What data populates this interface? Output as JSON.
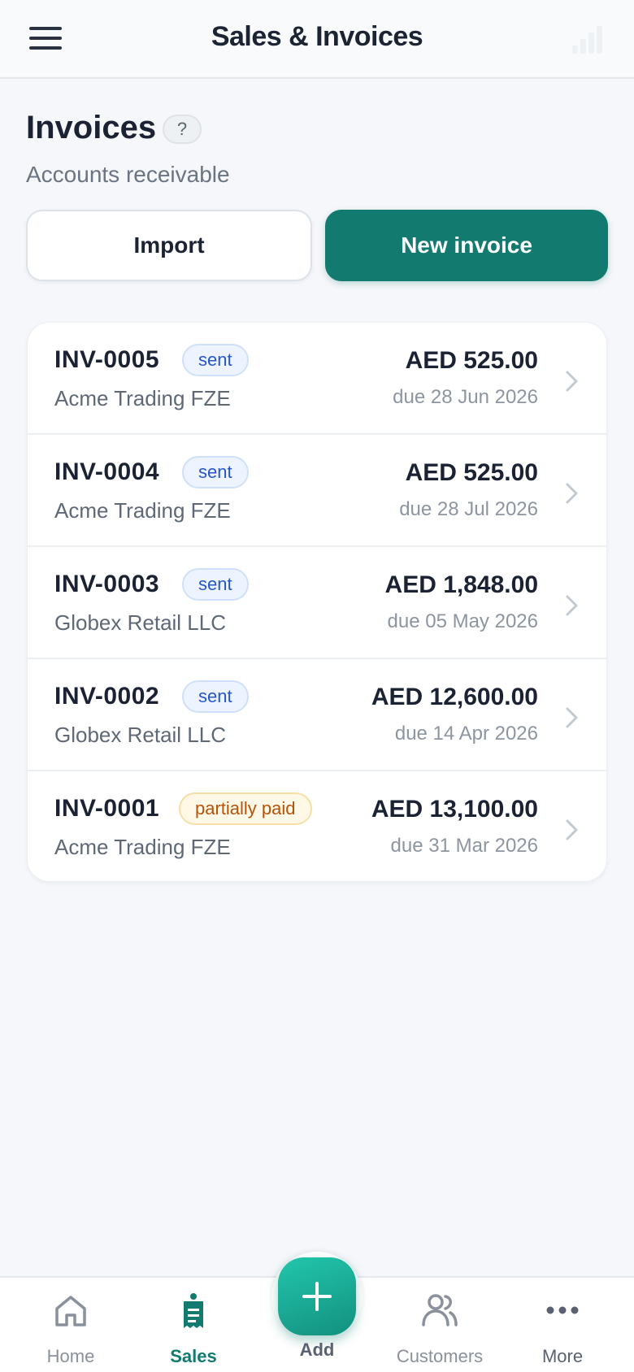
{
  "header": {
    "title": "Sales & Invoices",
    "menu_icon": "hamburger-menu-icon",
    "signal_icon": "signal-icon"
  },
  "page": {
    "title": "Invoices",
    "help": "?",
    "subtitle": "Accounts receivable"
  },
  "actions": {
    "import_label": "Import",
    "new_label": "New invoice"
  },
  "invoices": [
    {
      "number": "INV-0005",
      "status": "sent",
      "customer": "Acme Trading FZE",
      "amount": "AED 525.00",
      "due": "due 28 Jun 2026"
    },
    {
      "number": "INV-0004",
      "status": "sent",
      "customer": "Acme Trading FZE",
      "amount": "AED 525.00",
      "due": "due 28 Jul 2026"
    },
    {
      "number": "INV-0003",
      "status": "sent",
      "customer": "Globex Retail LLC",
      "amount": "AED 1,848.00",
      "due": "due 05 May 2026"
    },
    {
      "number": "INV-0002",
      "status": "sent",
      "customer": "Globex Retail LLC",
      "amount": "AED 12,600.00",
      "due": "due 14 Apr 2026"
    },
    {
      "number": "INV-0001",
      "status": "partially paid",
      "customer": "Acme Trading FZE",
      "amount": "AED 13,100.00",
      "due": "due 31 Mar 2026"
    }
  ],
  "nav": {
    "home": "Home",
    "sales": "Sales",
    "add": "Add",
    "customers": "Customers",
    "more": "More"
  },
  "colors": {
    "brand": "#137a6f",
    "accent": "#22c6ac",
    "status_sent": "#2656c9",
    "status_partial": "#b45309"
  }
}
